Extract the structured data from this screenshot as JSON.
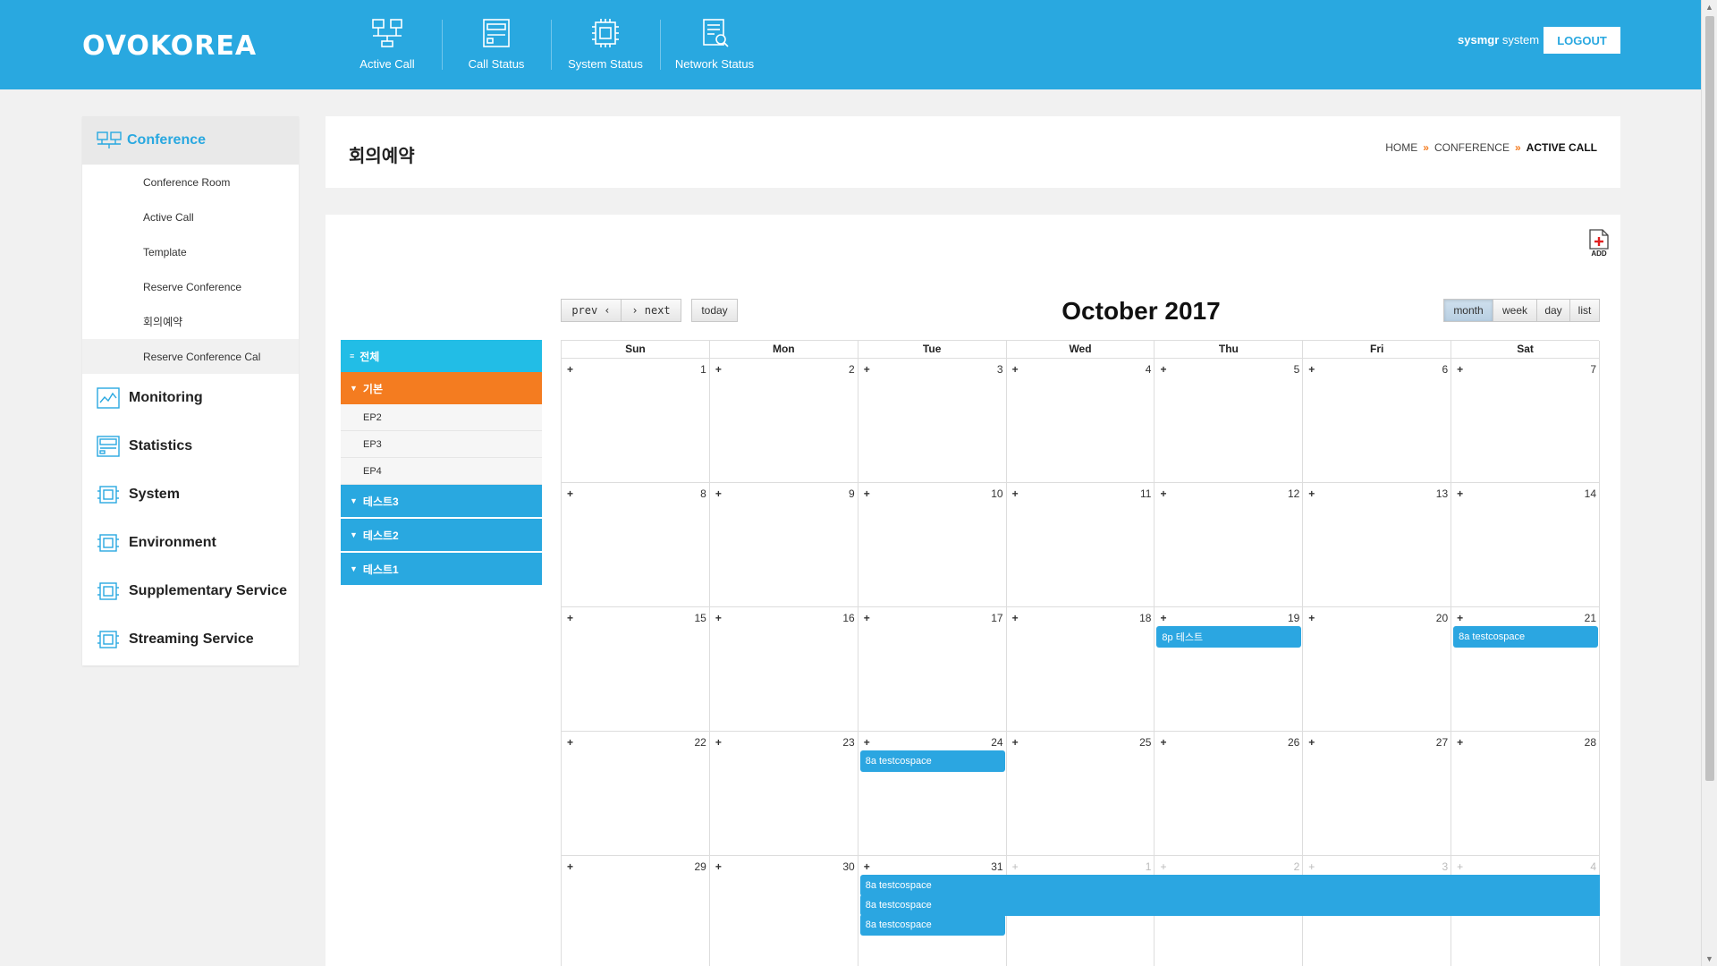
{
  "brand": {
    "logo": "OVOKOREA"
  },
  "topnav": [
    {
      "label": "Active Call",
      "icon": "network-computers-icon"
    },
    {
      "label": "Call Status",
      "icon": "server-panel-icon"
    },
    {
      "label": "System Status",
      "icon": "chip-icon"
    },
    {
      "label": "Network Status",
      "icon": "document-search-icon"
    }
  ],
  "user": {
    "id": "sysmgr",
    "name": "system",
    "logout_label": "LOGOUT"
  },
  "sidebar": {
    "head": "Conference",
    "sub_items": [
      "Conference Room",
      "Active Call",
      "Template",
      "Reserve Conference",
      "회의예약",
      "Reserve Conference Cal"
    ],
    "groups": [
      {
        "label": "Monitoring",
        "icon": "chart-monitor-icon"
      },
      {
        "label": "Statistics",
        "icon": "server-panel-icon"
      },
      {
        "label": "System",
        "icon": "chip-icon"
      },
      {
        "label": "Environment",
        "icon": "chip-icon"
      },
      {
        "label": "Supplementary Service",
        "icon": "chip-icon"
      },
      {
        "label": "Streaming Service",
        "icon": "chip-icon"
      }
    ]
  },
  "page": {
    "title": "회의예약",
    "breadcrumb": [
      "HOME",
      "CONFERENCE",
      "ACTIVE CALL"
    ],
    "add_label": "ADD"
  },
  "tree": {
    "all": "전체",
    "group_open": "기본",
    "leaves": [
      "EP2",
      "EP3",
      "EP4"
    ],
    "groups_closed": [
      "테스트3",
      "테스트2",
      "테스트1"
    ]
  },
  "calendar": {
    "title": "October 2017",
    "prev_label": "prev ‹",
    "next_label": "› next",
    "today_label": "today",
    "views": [
      "month",
      "week",
      "day",
      "list"
    ],
    "active_view": "month",
    "dow": [
      "Sun",
      "Mon",
      "Tue",
      "Wed",
      "Thu",
      "Fri",
      "Sat"
    ],
    "weeks": [
      [
        "1",
        "2",
        "3",
        "4",
        "5",
        "6",
        "7"
      ],
      [
        "8",
        "9",
        "10",
        "11",
        "12",
        "13",
        "14"
      ],
      [
        "15",
        "16",
        "17",
        "18",
        "19",
        "20",
        "21"
      ],
      [
        "22",
        "23",
        "24",
        "25",
        "26",
        "27",
        "28"
      ],
      [
        "29",
        "30",
        "31",
        "1",
        "2",
        "3",
        "4"
      ]
    ],
    "events": [
      {
        "text": "8p 테스트",
        "date": "2017-10-19"
      },
      {
        "text": "8a testcospace",
        "date": "2017-10-21"
      },
      {
        "text": "8a testcospace",
        "date": "2017-10-24"
      },
      {
        "text": "8a testcospace",
        "date": "2017-10-31",
        "end": "2017-11-04"
      },
      {
        "text": "8a testcospace",
        "date": "2017-10-31",
        "end": "2017-11-04"
      },
      {
        "text": "8a testcospace",
        "date": "2017-10-31"
      }
    ]
  },
  "colors": {
    "brand": "#29a8e0",
    "accent": "#f47c20",
    "tree_all": "#22bde6",
    "event": "#2ba6e1"
  }
}
